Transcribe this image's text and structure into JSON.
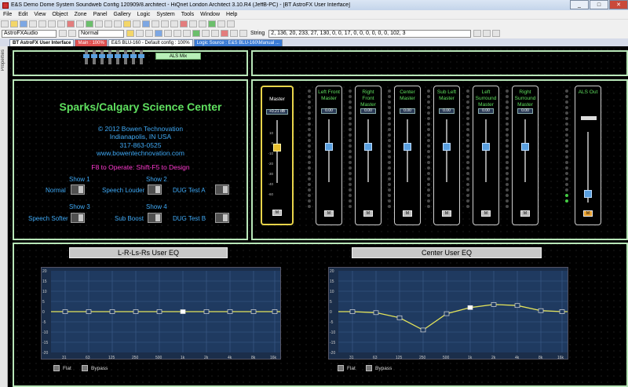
{
  "window": {
    "title": "E&S Demo Dome System Soundweb Config 120909/8.architect - HiQnet London Architect 3.10.R4 (JeffB-PC) - [BT AstroFX User Interface]",
    "min": "_",
    "max": "□",
    "close": "✕"
  },
  "menu": [
    "File",
    "Edit",
    "View",
    "Object",
    "Zone",
    "Panel",
    "Gallery",
    "Logic",
    "System",
    "Tools",
    "Window",
    "Help"
  ],
  "toolbar2": {
    "device": "AstroFXAudio",
    "mode": "Normal",
    "string_label": "String",
    "string_value": "2, 136, 20, 233, 27, 130, 0, 0, 17, 0, 0, 0, 0, 0, 0, 102, 3"
  },
  "tabs": [
    "BT AstroFX User Interface",
    "Main : 100%",
    "E&S BLU-160 - Default config : 100%",
    "Logic Source : E&S BLU-160\\Manual ..."
  ],
  "sidebar": {
    "label": "Properties"
  },
  "als_mix": "ALS Mix",
  "venue": {
    "title": "Sparks/Calgary Science Center",
    "copyright": "© 2012 Bowen Technovation",
    "city": "Indianapolis, IN USA",
    "phone": "317-863-0525",
    "web": "www.bowentechnovation.com",
    "instruction": "F8 to Operate: Shift-F5 to Design"
  },
  "shows": {
    "show1": "Show 1",
    "show2": "Show 2",
    "show3": "Show 3",
    "show4": "Show 4",
    "normal": "Normal",
    "speech_louder": "Speech Louder",
    "dug_a": "DUG Test A",
    "speech_softer": "Speech Softer",
    "sub_boost": "Sub Boost",
    "dug_b": "DUG Test B"
  },
  "mixer": {
    "master": {
      "label": "Master",
      "value": "+0.21 dB",
      "m": "M"
    },
    "channels": [
      {
        "label": "Left Front Master",
        "value": "0.00",
        "m": "M"
      },
      {
        "label": "Right Front Master",
        "value": "0.00",
        "m": "M"
      },
      {
        "label": "Center Master",
        "value": "0.00",
        "m": "M"
      },
      {
        "label": "Sub Left Master",
        "value": "0.00",
        "m": "M"
      },
      {
        "label": "Left Surround Master",
        "value": "0.00",
        "m": "M"
      },
      {
        "label": "Right Surround Master",
        "value": "0.00",
        "m": "M"
      }
    ],
    "als": {
      "label": "ALS Out",
      "m": "M"
    },
    "scale": [
      "10",
      "0",
      "-10",
      "-20",
      "-30",
      "-40",
      "-60"
    ]
  },
  "eq": [
    {
      "title": "L-R-Ls-Rs User EQ",
      "flat": "Flat",
      "bypass": "Bypass",
      "y_ticks": [
        "20",
        "15",
        "10",
        "5",
        "0",
        "-5",
        "-10",
        "-15",
        "-20"
      ],
      "x_ticks": [
        "31",
        "63",
        "125",
        "250",
        "500",
        "1k",
        "2k",
        "4k",
        "8k",
        "16k"
      ],
      "curve": [
        0,
        0,
        0,
        0,
        0,
        0,
        0,
        0,
        0,
        0
      ]
    },
    {
      "title": "Center User EQ",
      "flat": "Flat",
      "bypass": "Bypass",
      "y_ticks": [
        "20",
        "15",
        "10",
        "5",
        "0",
        "-5",
        "-10",
        "-15",
        "-20"
      ],
      "x_ticks": [
        "31",
        "63",
        "125",
        "250",
        "500",
        "1k",
        "2k",
        "4k",
        "8k",
        "16k"
      ],
      "curve": [
        0,
        -0.5,
        -3,
        -9,
        -1,
        2,
        3.5,
        3,
        0.5,
        0
      ]
    }
  ],
  "colors": {
    "panel_border": "#b8e6b8",
    "green_text": "#5fe05f",
    "blue_text": "#3fa9f5",
    "magenta": "#ff3ad0",
    "eq_curve": "#e3e35a"
  }
}
